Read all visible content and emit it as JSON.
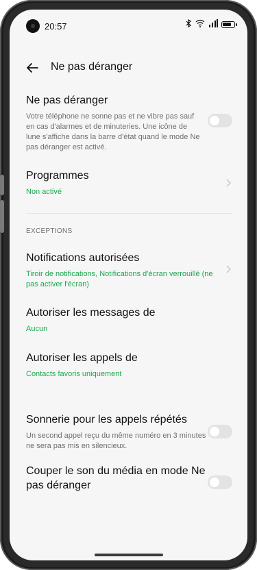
{
  "status_bar": {
    "time": "20:57",
    "icons": [
      "bluetooth-icon",
      "wifi-icon",
      "signal-icon",
      "battery-icon"
    ]
  },
  "header": {
    "title": "Ne pas déranger",
    "back_icon": "arrow-left-icon"
  },
  "settings": {
    "dnd": {
      "title": "Ne pas déranger",
      "description": "Votre téléphone ne sonne pas et ne vibre pas sauf en cas d'alarmes et de minuteries. Une icône de lune s'affiche dans la barre d'état quand le mode Ne pas déranger est activé.",
      "enabled": false
    },
    "schedules": {
      "title": "Programmes",
      "value": "Non activé"
    },
    "exceptions_header": "EXCEPTIONS",
    "allowed_notifications": {
      "title": "Notifications autorisées",
      "value": "Tiroir de notifications, Notifications d'écran verrouillé (ne pas activer l'écran)"
    },
    "allow_messages": {
      "title": "Autoriser les messages de",
      "value": "Aucun"
    },
    "allow_calls": {
      "title": "Autoriser les appels de",
      "value": "Contacts favoris uniquement"
    },
    "repeated_calls": {
      "title": "Sonnerie pour les appels répétés",
      "description": "Un second appel reçu du même numéro en 3 minutes ne sera pas mis en silencieux.",
      "enabled": false
    },
    "mute_media": {
      "title": "Couper le son du média en mode Ne pas déranger",
      "enabled": false
    }
  },
  "colors": {
    "accent_green": "#1aa84b",
    "background": "#f6f6f6",
    "toggle_off": "#e3e3e3"
  }
}
